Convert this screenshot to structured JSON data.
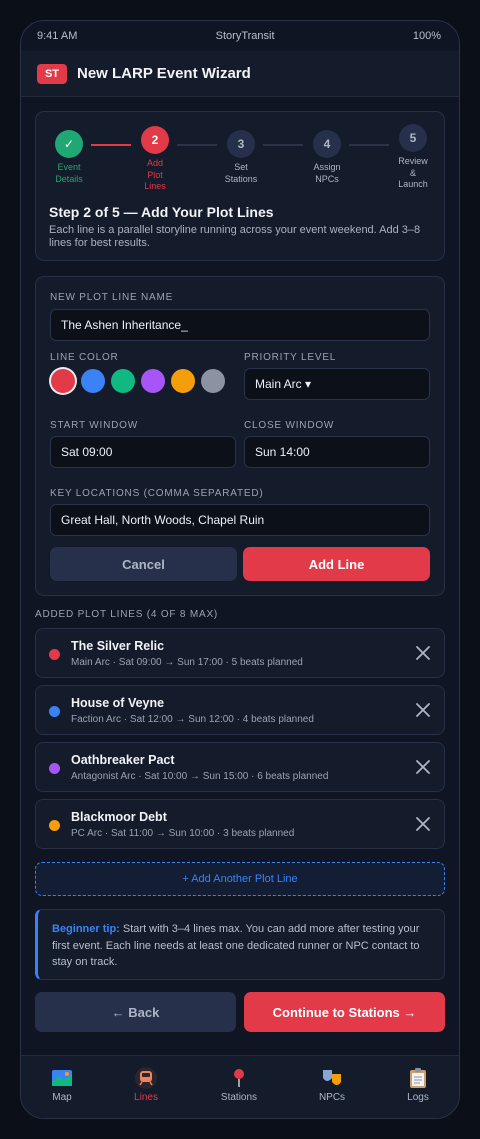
{
  "status_bar": {
    "time": "9:41 AM",
    "app": "StoryTransit",
    "battery": "100%"
  },
  "app_bar": {
    "logo": "ST",
    "title": "New LARP Event Wizard"
  },
  "stepper": {
    "steps": [
      {
        "number": "✓",
        "label": "Event\nDetails",
        "state": "done"
      },
      {
        "number": "2",
        "label": "Add\nPlot\nLines",
        "state": "active"
      },
      {
        "number": "3",
        "label": "Set\nStations",
        "state": "todo"
      },
      {
        "number": "4",
        "label": "Assign\nNPCs",
        "state": "todo"
      },
      {
        "number": "5",
        "label": "Review\n&\nLaunch",
        "state": "todo"
      }
    ],
    "title": "Step 2 of 5 — Add Your Plot Lines",
    "description": "Each line is a parallel storyline running across your event weekend. Add 3–8 lines for best results."
  },
  "form": {
    "name_label": "NEW PLOT LINE NAME",
    "name_value": "The Ashen Inheritance_",
    "color_label": "LINE COLOR",
    "colors": [
      "#e23a48",
      "#3b82f6",
      "#10b981",
      "#a855f7",
      "#f59e0b",
      "#8b93a3"
    ],
    "selected_color": "#e23a48",
    "priority_label": "PRIORITY LEVEL",
    "priority_value": "Main Arc ▾",
    "start_label": "START WINDOW",
    "start_value": "Sat 09:00",
    "close_label": "CLOSE WINDOW",
    "close_value": "Sun 14:00",
    "locations_label": "KEY LOCATIONS (COMMA SEPARATED)",
    "locations_value": "Great Hall, North Woods, Chapel Ruin",
    "cancel": "Cancel",
    "add": "Add Line"
  },
  "added": {
    "label": "ADDED PLOT LINES (4 OF 8 MAX)",
    "items": [
      {
        "name": "The Silver Relic",
        "meta": "Main Arc · Sat 09:00 → Sun 17:00 · 5 beats planned",
        "color": "#e23a48"
      },
      {
        "name": "House of Veyne",
        "meta": "Faction Arc · Sat 12:00 → Sun 12:00 · 4 beats planned",
        "color": "#3b82f6"
      },
      {
        "name": "Oathbreaker Pact",
        "meta": "Antagonist Arc · Sat 10:00 → Sun 15:00 · 6 beats planned",
        "color": "#a855f7"
      },
      {
        "name": "Blackmoor Debt",
        "meta": "PC Arc · Sat 11:00 → Sun 10:00 · 3 beats planned",
        "color": "#f59e0b"
      }
    ],
    "add_another": "+ Add Another Plot Line"
  },
  "tip": {
    "lead": "Beginner tip:",
    "body": " Start with 3–4 lines max. You can add more after testing your first event. Each line needs at least one dedicated runner or NPC contact to stay on track."
  },
  "nav": {
    "back": "← Back",
    "next": "Continue to Stations →"
  },
  "tabs": [
    {
      "label": "Map",
      "icon": "map-icon"
    },
    {
      "label": "Lines",
      "icon": "train-icon",
      "active": true
    },
    {
      "label": "Stations",
      "icon": "pin-icon"
    },
    {
      "label": "NPCs",
      "icon": "masks-icon"
    },
    {
      "label": "Logs",
      "icon": "clipboard-icon"
    }
  ]
}
